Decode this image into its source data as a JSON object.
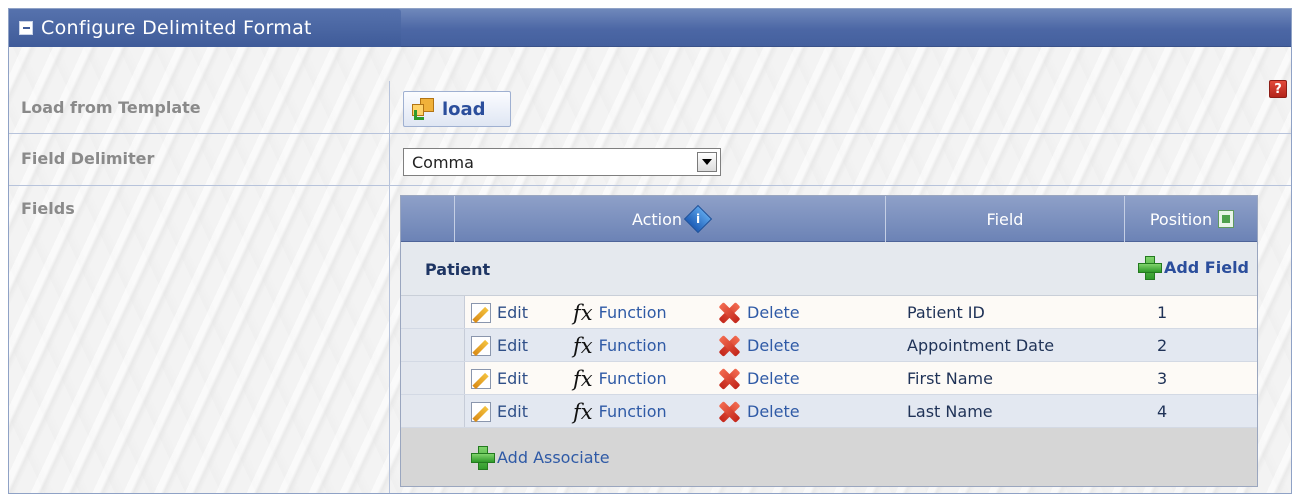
{
  "panel": {
    "title": "Configure Delimited Format",
    "help_glyph": "?"
  },
  "rows": {
    "template_label": "Load from Template",
    "delimiter_label": "Field Delimiter",
    "fields_label": "Fields"
  },
  "load_button": {
    "label": "load"
  },
  "delimiter_select": {
    "value": "Comma"
  },
  "grid": {
    "columns": {
      "action": "Action",
      "field": "Field",
      "position": "Position"
    },
    "group": {
      "name": "Patient",
      "add_field_label": "Add Field"
    },
    "row_actions": {
      "edit": "Edit",
      "function": "Function",
      "delete": "Delete"
    },
    "rows": [
      {
        "field": "Patient ID",
        "position": "1"
      },
      {
        "field": "Appointment Date",
        "position": "2"
      },
      {
        "field": "First Name",
        "position": "3"
      },
      {
        "field": "Last Name",
        "position": "4"
      }
    ],
    "add_associate_label": "Add Associate"
  },
  "icons": {
    "collapse": "collapse-icon",
    "help": "help-icon",
    "load": "load-template-icon",
    "info": "info-icon",
    "sheet": "spreadsheet-icon",
    "add": "plus-icon",
    "edit": "edit-icon",
    "function": "fx-icon",
    "delete": "delete-icon"
  },
  "colors": {
    "title_bar": "#4c67a5",
    "link": "#2f5aa6",
    "label": "#8a8a8a"
  }
}
